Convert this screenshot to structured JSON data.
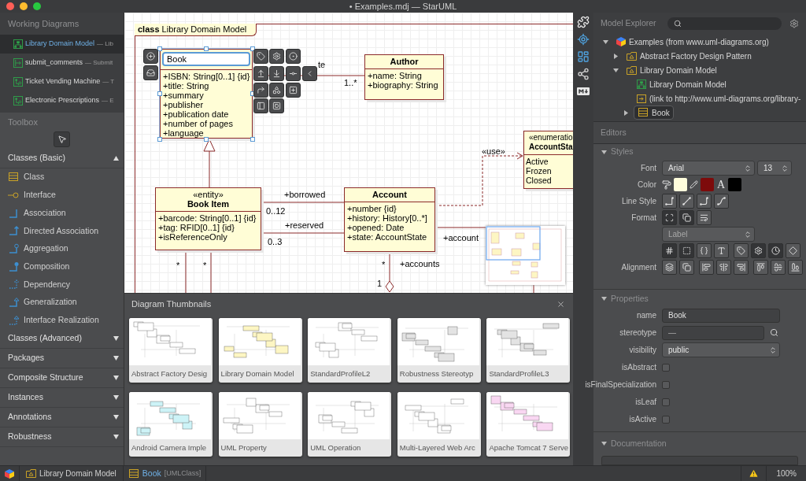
{
  "window": {
    "title": "• Examples.mdj — StarUML"
  },
  "working_diagrams": {
    "title": "Working Diagrams",
    "items": [
      {
        "name": "Library Domain Model",
        "detail": "— Lib",
        "kind": "class",
        "selected": true
      },
      {
        "name": "submit_comments",
        "detail": "— Submit",
        "kind": "sequence",
        "selected": false
      },
      {
        "name": "Ticket Vending Machine",
        "detail": "— T",
        "kind": "usecase",
        "selected": false
      },
      {
        "name": "Electronic Prescriptions",
        "detail": "— E",
        "kind": "usecase",
        "selected": false
      }
    ]
  },
  "toolbox": {
    "title": "Toolbox",
    "groups": [
      {
        "label": "Classes (Basic)",
        "expanded": true,
        "items": [
          {
            "label": "Class",
            "kind": "class"
          },
          {
            "label": "Interface",
            "kind": "interface"
          },
          {
            "label": "Association",
            "kind": "association"
          },
          {
            "label": "Directed Association",
            "kind": "directed"
          },
          {
            "label": "Aggregation",
            "kind": "aggregation"
          },
          {
            "label": "Composition",
            "kind": "composition"
          },
          {
            "label": "Dependency",
            "kind": "dependency"
          },
          {
            "label": "Generalization",
            "kind": "generalization"
          },
          {
            "label": "Interface Realization",
            "kind": "realization"
          }
        ]
      },
      {
        "label": "Classes (Advanced)",
        "expanded": false
      },
      {
        "label": "Packages",
        "expanded": false
      },
      {
        "label": "Composite Structure",
        "expanded": false
      },
      {
        "label": "Instances",
        "expanded": false
      },
      {
        "label": "Annotations",
        "expanded": false
      },
      {
        "label": "Robustness",
        "expanded": false
      }
    ]
  },
  "canvas": {
    "frame": {
      "keyword": "class",
      "name": "Library Domain Model"
    },
    "classes": [
      {
        "name": "Book",
        "editing": true,
        "attributes": [
          "+ISBN: String[0..1] {id}",
          "+title: String",
          "+summary",
          "+publisher",
          "+publication date",
          "+number of pages",
          "+language"
        ]
      },
      {
        "name": "Author",
        "editing": false,
        "attributes": [
          "+name: String",
          "+biography: String"
        ]
      },
      {
        "stereotype": "«entity»",
        "name": "Book Item",
        "editing": false,
        "attributes": [
          "+barcode: String[0..1] {id}",
          "+tag: RFID[0..1] {id}",
          "+isReferenceOnly"
        ]
      },
      {
        "name": "Account",
        "editing": false,
        "attributes": [
          "+number {id}",
          "+history: History[0..*]",
          "+opened: Date",
          "+state: AccountState"
        ]
      },
      {
        "stereotype": "«enumeratio",
        "name": "AccountSta",
        "editing": false,
        "attributes": [
          "Active",
          "Frozen",
          "Closed"
        ]
      }
    ],
    "labels": [
      "te",
      "1..*",
      "+borrowed",
      "0..12",
      "+reserved",
      "0..3",
      "«use»",
      "+account",
      "*",
      "*",
      "*",
      "+accounts",
      "1"
    ]
  },
  "thumbnails": {
    "title": "Diagram Thumbnails",
    "cards": [
      {
        "label": "Abstract Factory Desig"
      },
      {
        "label": "Library Domain Model"
      },
      {
        "label": "StandardProfileL2"
      },
      {
        "label": "Robustness Stereotyp"
      },
      {
        "label": "StandardProfileL3"
      },
      {
        "label": "Android Camera Imple"
      },
      {
        "label": "UML Property"
      },
      {
        "label": "UML Operation"
      },
      {
        "label": "Multi-Layered Web Arc"
      },
      {
        "label": "Apache Tomcat 7 Serve"
      }
    ]
  },
  "model_explorer": {
    "title": "Model Explorer",
    "tree": [
      {
        "label": "Examples (from www.uml-diagrams.org)",
        "kind": "project",
        "expanded": true,
        "selected": false,
        "children": [
          {
            "label": "Abstract Factory Design Pattern",
            "kind": "model",
            "expanded": false,
            "selected": false
          },
          {
            "label": "Library Domain Model",
            "kind": "model",
            "expanded": true,
            "selected": false,
            "children": [
              {
                "label": "Library Domain Model",
                "kind": "diagram",
                "selected": false
              },
              {
                "label": "(link to http://www.uml-diagrams.org/library-",
                "kind": "link",
                "selected": false
              },
              {
                "label": "Book",
                "kind": "class",
                "expanded": false,
                "selected": true
              }
            ]
          }
        ]
      }
    ]
  },
  "editors": {
    "title": "Editors",
    "styles": {
      "title": "Styles",
      "expanded": true,
      "font_label": "Font",
      "font": "Arial",
      "font_size": "13",
      "color_label": "Color",
      "swatches": [
        {
          "color": "#fffddc"
        },
        {
          "color": "#7d0b0b"
        },
        {
          "color": "#000000"
        }
      ],
      "text_glyph": "A",
      "line_style_label": "Line Style",
      "line_styles": [
        {
          "kind": "rectilinear"
        },
        {
          "kind": "oblique"
        },
        {
          "kind": "rounded"
        },
        {
          "kind": "curve"
        }
      ],
      "format_label": "Format",
      "format_buttons": [
        {
          "kind": "resize",
          "pressed": true
        },
        {
          "kind": "shadow",
          "pressed": true
        },
        {
          "kind": "wrap",
          "pressed": false
        }
      ],
      "label_select": "Label",
      "alignment_label": "Alignment",
      "toggles": [
        {
          "kind": "hash",
          "pressed": true
        },
        {
          "kind": "box",
          "pressed": true
        },
        {
          "kind": "braces",
          "pressed": false
        },
        {
          "kind": "type",
          "pressed": false
        },
        {
          "kind": "tag",
          "pressed": false
        },
        {
          "kind": "gear",
          "pressed": true
        },
        {
          "kind": "clock",
          "pressed": true
        },
        {
          "kind": "diamond",
          "pressed": false
        }
      ],
      "alignment": [
        {
          "kind": "front"
        },
        {
          "kind": "back"
        },
        {
          "kind": "left"
        },
        {
          "kind": "center"
        },
        {
          "kind": "right"
        },
        {
          "kind": "top"
        },
        {
          "kind": "middle"
        },
        {
          "kind": "bottom"
        }
      ]
    },
    "properties": {
      "title": "Properties",
      "expanded": true,
      "fields": [
        {
          "label": "name",
          "kind": "text",
          "value": "Book"
        },
        {
          "label": "stereotype",
          "kind": "search",
          "value": "—"
        },
        {
          "label": "visibility",
          "kind": "select",
          "value": "public"
        },
        {
          "label": "isAbstract",
          "kind": "checkbox",
          "checked": false
        },
        {
          "label": "isFinalSpecialization",
          "kind": "checkbox",
          "checked": false
        },
        {
          "label": "isLeaf",
          "kind": "checkbox",
          "checked": false
        },
        {
          "label": "isActive",
          "kind": "checkbox",
          "checked": false
        }
      ]
    },
    "documentation": {
      "title": "Documentation",
      "expanded": true
    }
  },
  "status_bar": {
    "diagram": "Library Domain Model",
    "element": "Book",
    "element_type": "[UMLClass]",
    "zoom": "100%"
  }
}
